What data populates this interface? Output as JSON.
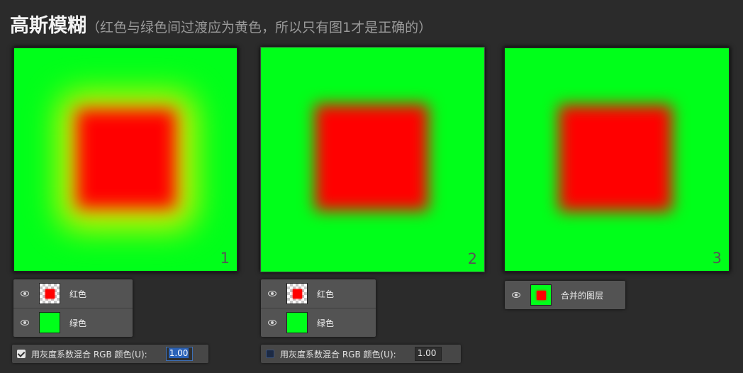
{
  "title": {
    "main": "高斯模糊",
    "sub": "（红色与绿色间过渡应为黄色，所以只有图1才是正确的）"
  },
  "panels": [
    {
      "number": "1"
    },
    {
      "number": "2"
    },
    {
      "number": "3"
    }
  ],
  "layers1": [
    {
      "name": "红色",
      "thumb": "red-square-transparent",
      "visible": true
    },
    {
      "name": "绿色",
      "thumb": "green-fill",
      "visible": true
    }
  ],
  "layers2": [
    {
      "name": "红色",
      "thumb": "red-square-transparent",
      "visible": true
    },
    {
      "name": "绿色",
      "thumb": "green-fill",
      "visible": true
    }
  ],
  "layers3": [
    {
      "name": "合并的图层",
      "thumb": "red-on-green",
      "visible": true
    }
  ],
  "option1": {
    "label": "用灰度系数混合 RGB 颜色(U):",
    "value": "1.00",
    "checked": true
  },
  "option2": {
    "label": "用灰度系数混合 RGB 颜色(U):",
    "value": "1.00",
    "checked": false
  },
  "colors": {
    "background": "#2b2b2b",
    "green": "#00ff1a",
    "red": "#ff0000",
    "transition_yellow": "#d4f000"
  }
}
